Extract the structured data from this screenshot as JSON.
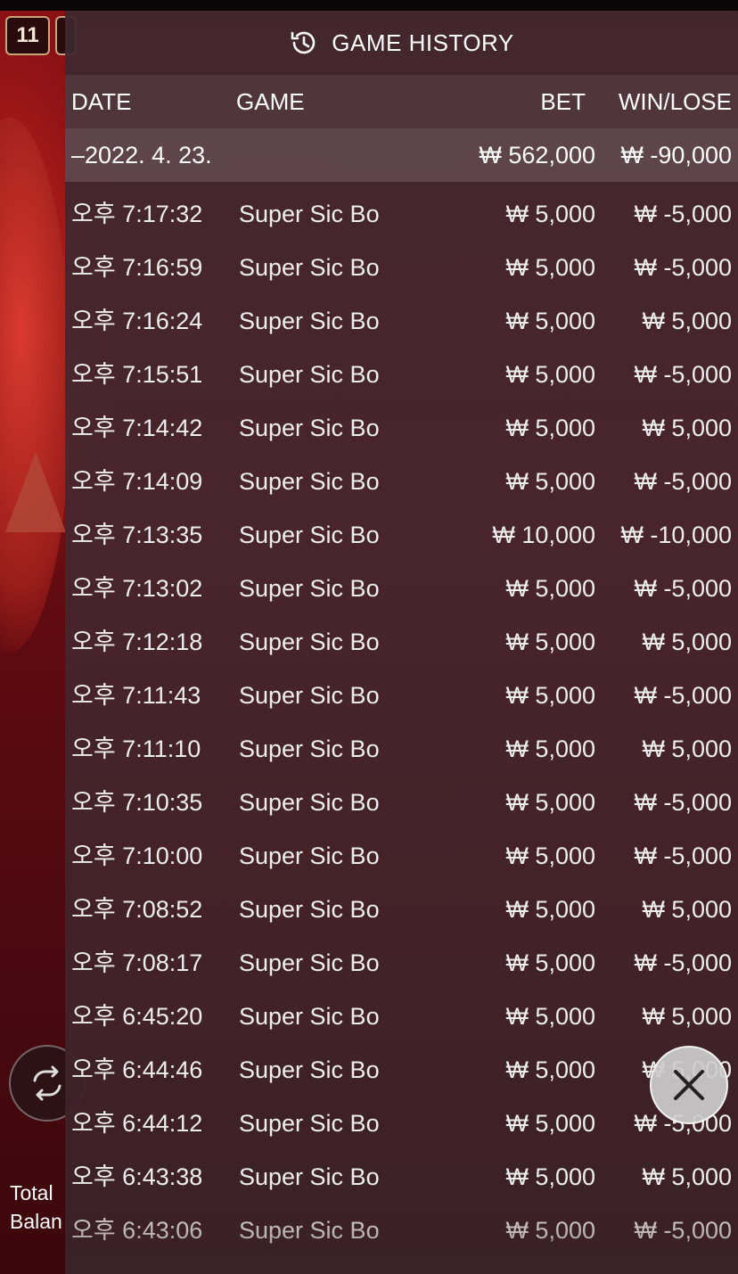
{
  "background": {
    "round_number": "11",
    "total_balance_label_line1": "Total",
    "total_balance_label_line2": "Balan"
  },
  "panel": {
    "title": "GAME HISTORY",
    "title_icon": "history-clock-icon",
    "columns": {
      "date": "DATE",
      "game": "GAME",
      "bet": "BET",
      "win_lose": "WIN/LOSE"
    },
    "date_group": {
      "date": "–2022. 4. 23.",
      "bet_total": "₩ 562,000",
      "win_lose_total": "₩ -90,000"
    },
    "rows": [
      {
        "time": "오후 7:17:32",
        "game": "Super Sic Bo",
        "bet": "₩ 5,000",
        "result": "₩ -5,000"
      },
      {
        "time": "오후 7:16:59",
        "game": "Super Sic Bo",
        "bet": "₩ 5,000",
        "result": "₩ -5,000"
      },
      {
        "time": "오후 7:16:24",
        "game": "Super Sic Bo",
        "bet": "₩ 5,000",
        "result": "₩ 5,000"
      },
      {
        "time": "오후 7:15:51",
        "game": "Super Sic Bo",
        "bet": "₩ 5,000",
        "result": "₩ -5,000"
      },
      {
        "time": "오후 7:14:42",
        "game": "Super Sic Bo",
        "bet": "₩ 5,000",
        "result": "₩ 5,000"
      },
      {
        "time": "오후 7:14:09",
        "game": "Super Sic Bo",
        "bet": "₩ 5,000",
        "result": "₩ -5,000"
      },
      {
        "time": "오후 7:13:35",
        "game": "Super Sic Bo",
        "bet": "₩ 10,000",
        "result": "₩ -10,000"
      },
      {
        "time": "오후 7:13:02",
        "game": "Super Sic Bo",
        "bet": "₩ 5,000",
        "result": "₩ -5,000"
      },
      {
        "time": "오후 7:12:18",
        "game": "Super Sic Bo",
        "bet": "₩ 5,000",
        "result": "₩ 5,000"
      },
      {
        "time": "오후 7:11:43",
        "game": "Super Sic Bo",
        "bet": "₩ 5,000",
        "result": "₩ -5,000"
      },
      {
        "time": "오후 7:11:10",
        "game": "Super Sic Bo",
        "bet": "₩ 5,000",
        "result": "₩ 5,000"
      },
      {
        "time": "오후 7:10:35",
        "game": "Super Sic Bo",
        "bet": "₩ 5,000",
        "result": "₩ -5,000"
      },
      {
        "time": "오후 7:10:00",
        "game": "Super Sic Bo",
        "bet": "₩ 5,000",
        "result": "₩ -5,000"
      },
      {
        "time": "오후 7:08:52",
        "game": "Super Sic Bo",
        "bet": "₩ 5,000",
        "result": "₩ 5,000"
      },
      {
        "time": "오후 7:08:17",
        "game": "Super Sic Bo",
        "bet": "₩ 5,000",
        "result": "₩ -5,000"
      },
      {
        "time": "오후 6:45:20",
        "game": "Super Sic Bo",
        "bet": "₩ 5,000",
        "result": "₩ 5,000"
      },
      {
        "time": "오후 6:44:46",
        "game": "Super Sic Bo",
        "bet": "₩ 5,000",
        "result": "₩ 5,000"
      },
      {
        "time": "오후 6:44:12",
        "game": "Super Sic Bo",
        "bet": "₩ 5,000",
        "result": "₩ -5,000"
      },
      {
        "time": "오후 6:43:38",
        "game": "Super Sic Bo",
        "bet": "₩ 5,000",
        "result": "₩ 5,000"
      },
      {
        "time": "오후 6:43:06",
        "game": "Super Sic Bo",
        "bet": "₩ 5,000",
        "result": "₩ -5,000"
      }
    ],
    "close_icon": "close-icon"
  }
}
